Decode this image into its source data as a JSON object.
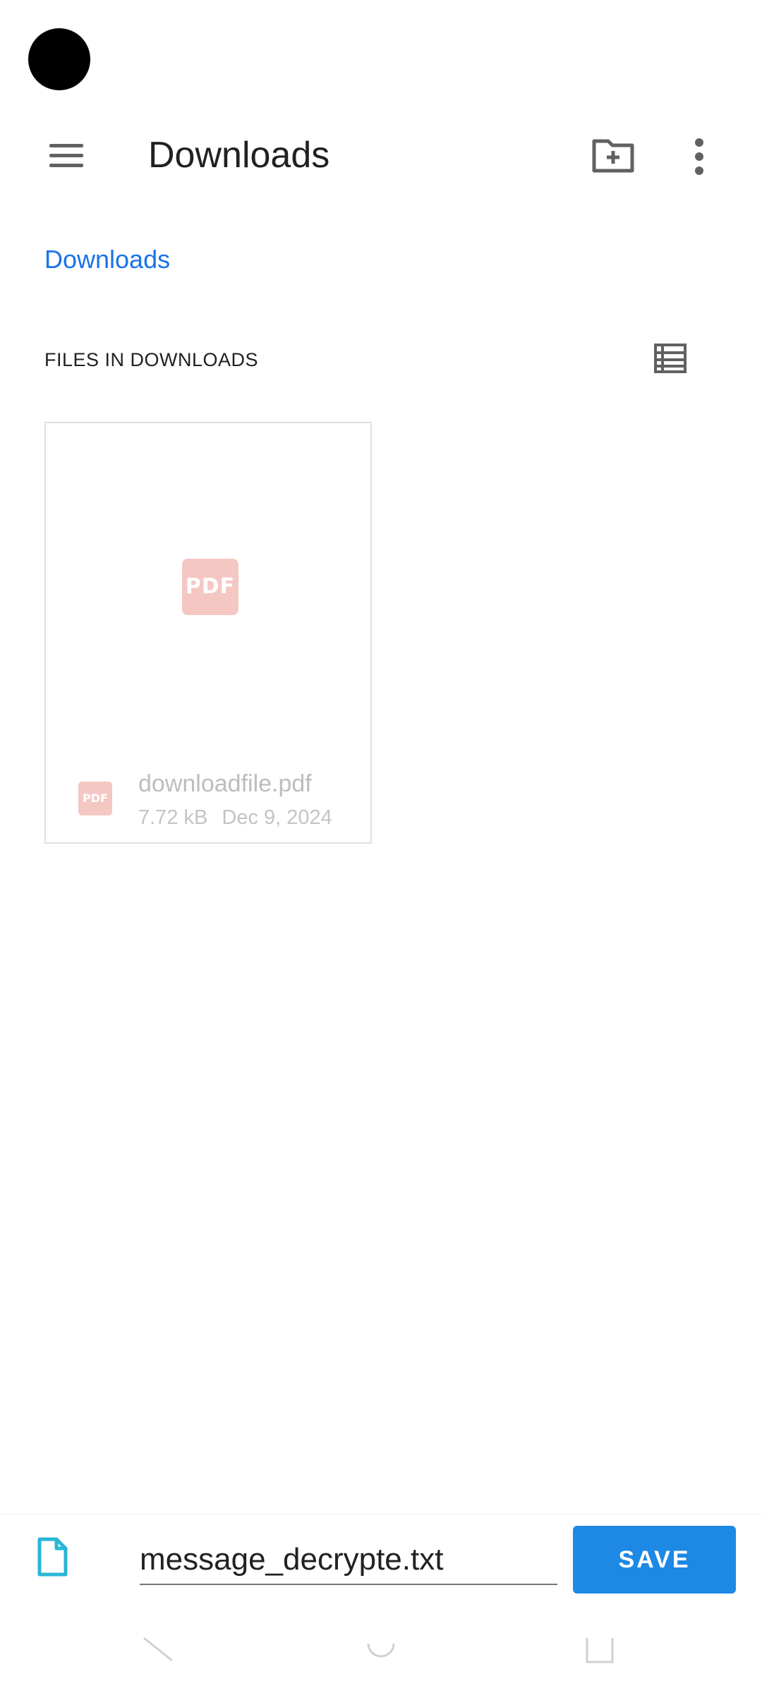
{
  "toolbar": {
    "title": "Downloads",
    "icons": [
      "menu-icon",
      "new-folder-icon",
      "more-vert-icon"
    ]
  },
  "breadcrumb": {
    "root": "Downloads"
  },
  "section": {
    "header": "FILES IN DOWNLOADS",
    "view_icon": "list-view-icon"
  },
  "files": [
    {
      "thumb_label": "PDF",
      "type_label": "PDF",
      "name": "downloadfile.pdf",
      "size": "7.72 kB",
      "date": "Dec 9, 2024"
    }
  ],
  "save_bar": {
    "file_icon": "document-icon",
    "filename_value": "message_decrypte.txt",
    "save_label": "SAVE"
  },
  "colors": {
    "accent": "#1e88e5",
    "link": "#1a73e8",
    "pdf_badge": "#f4c7c3",
    "doc_icon": "#29b6d5"
  }
}
